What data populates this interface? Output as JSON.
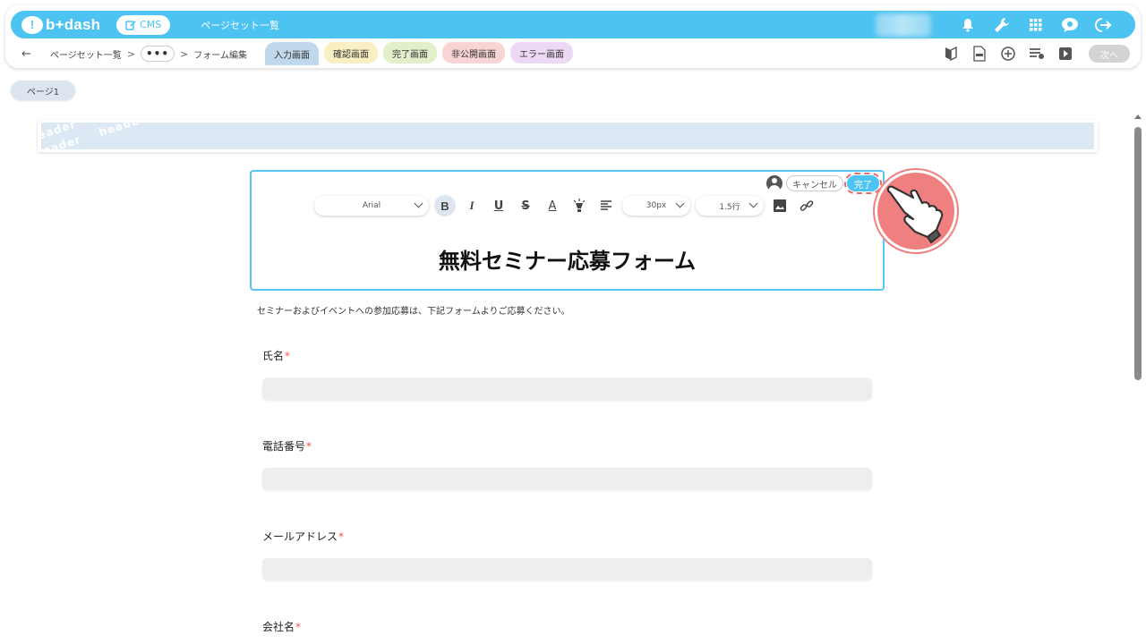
{
  "topbar": {
    "logo": "b+dash",
    "cms_label": "CMS",
    "title": "ページセット一覧"
  },
  "subbar": {
    "breadcrumbs": [
      "ページセット一覧",
      "フォーム編集"
    ],
    "more": "•••",
    "tabs": [
      {
        "label": "入力画面",
        "active": true
      },
      {
        "label": "確認画面"
      },
      {
        "label": "完了画面"
      },
      {
        "label": "非公開画面"
      },
      {
        "label": "エラー画面"
      }
    ],
    "next_label": "次へ"
  },
  "page_tab": "ページ1",
  "header_block": {
    "pattern_text": "header"
  },
  "editor": {
    "cancel_label": "キャンセル",
    "done_label": "完了",
    "font_select": "Arial",
    "size_select": "30px",
    "line_height_select": "1.5行",
    "title": "無料セミナー応募フォーム"
  },
  "description": "セミナーおよびイベントへの参加応募は、下記フォームよりご応募ください。",
  "fields": [
    {
      "label": "氏名",
      "required": "*"
    },
    {
      "label": "電話番号",
      "required": "*"
    },
    {
      "label": "メールアドレス",
      "required": "*"
    },
    {
      "label": "会社名",
      "required": "*"
    }
  ],
  "colors": {
    "brand": "#4cc3f0",
    "highlight": "#f08080"
  }
}
